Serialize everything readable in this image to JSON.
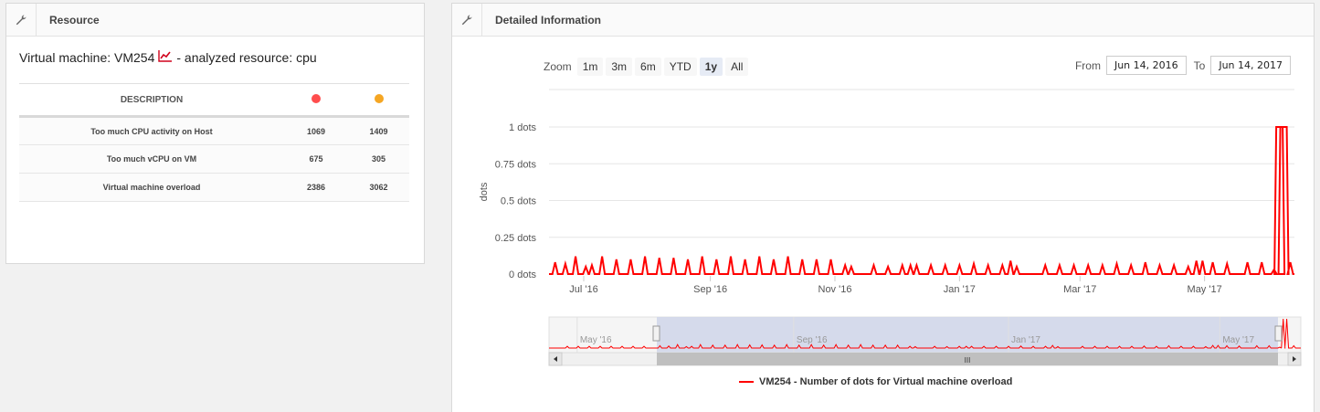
{
  "resource_panel": {
    "title": "Resource",
    "vm_prefix": "Virtual machine: VM254",
    "vm_suffix": "- analyzed resource: cpu",
    "table": {
      "header": "DESCRIPTION",
      "dot_colors": [
        "#ff4d4d",
        "#f5a623"
      ],
      "rows": [
        {
          "label": "Too much CPU activity on Host",
          "red": "1069",
          "orange": "1409"
        },
        {
          "label": "Too much vCPU on VM",
          "red": "675",
          "orange": "305"
        },
        {
          "label": "Virtual machine overload",
          "red": "2386",
          "orange": "3062"
        }
      ]
    }
  },
  "details_panel": {
    "title": "Detailed Information",
    "zoom": {
      "label": "Zoom",
      "buttons": [
        "1m",
        "3m",
        "6m",
        "YTD",
        "1y",
        "All"
      ],
      "active": "1y"
    },
    "range": {
      "from_label": "From",
      "from_value": "Jun 14, 2016",
      "to_label": "To",
      "to_value": "Jun 14, 2017"
    },
    "navigator_labels": [
      "May '16",
      "Sep '16",
      "Jan '17",
      "May '17"
    ],
    "navigator_scroll_symbol": "III"
  },
  "chart_data": {
    "type": "line",
    "ylabel": "dots",
    "y_ticks": [
      "0 dots",
      "0.25 dots",
      "0.5 dots",
      "0.75 dots",
      "1 dots"
    ],
    "ylim": [
      0,
      1
    ],
    "x_ticks": [
      "Jul '16",
      "Sep '16",
      "Nov '16",
      "Jan '17",
      "Mar '17",
      "May '17"
    ],
    "x_range": [
      "2016-06-14",
      "2017-06-14"
    ],
    "series": [
      {
        "name": "VM254 - Number of dots for Virtual machine overload",
        "color": "#ff0000",
        "peaks": [
          [
            "2016-06-17",
            0.08
          ],
          [
            "2016-06-22",
            0.07
          ],
          [
            "2016-06-27",
            0.12
          ],
          [
            "2016-07-02",
            0.05
          ],
          [
            "2016-07-05",
            0.06
          ],
          [
            "2016-07-10",
            0.12
          ],
          [
            "2016-07-17",
            0.1
          ],
          [
            "2016-07-24",
            0.1
          ],
          [
            "2016-07-31",
            0.12
          ],
          [
            "2016-08-07",
            0.11
          ],
          [
            "2016-08-14",
            0.11
          ],
          [
            "2016-08-21",
            0.1
          ],
          [
            "2016-08-28",
            0.12
          ],
          [
            "2016-09-04",
            0.1
          ],
          [
            "2016-09-11",
            0.12
          ],
          [
            "2016-09-18",
            0.1
          ],
          [
            "2016-09-25",
            0.12
          ],
          [
            "2016-10-02",
            0.1
          ],
          [
            "2016-10-09",
            0.12
          ],
          [
            "2016-10-16",
            0.1
          ],
          [
            "2016-10-23",
            0.1
          ],
          [
            "2016-10-30",
            0.1
          ],
          [
            "2016-11-06",
            0.06
          ],
          [
            "2016-11-09",
            0.05
          ],
          [
            "2016-11-20",
            0.06
          ],
          [
            "2016-11-27",
            0.05
          ],
          [
            "2016-12-04",
            0.06
          ],
          [
            "2016-12-08",
            0.06
          ],
          [
            "2016-12-11",
            0.06
          ],
          [
            "2016-12-18",
            0.06
          ],
          [
            "2016-12-25",
            0.06
          ],
          [
            "2017-01-01",
            0.06
          ],
          [
            "2017-01-08",
            0.07
          ],
          [
            "2017-01-15",
            0.06
          ],
          [
            "2017-01-22",
            0.06
          ],
          [
            "2017-01-26",
            0.09
          ],
          [
            "2017-01-29",
            0.05
          ],
          [
            "2017-02-12",
            0.06
          ],
          [
            "2017-02-19",
            0.06
          ],
          [
            "2017-02-26",
            0.06
          ],
          [
            "2017-03-05",
            0.06
          ],
          [
            "2017-03-12",
            0.06
          ],
          [
            "2017-03-19",
            0.07
          ],
          [
            "2017-03-26",
            0.06
          ],
          [
            "2017-04-02",
            0.08
          ],
          [
            "2017-04-09",
            0.06
          ],
          [
            "2017-04-16",
            0.06
          ],
          [
            "2017-04-23",
            0.05
          ],
          [
            "2017-04-27",
            0.09
          ],
          [
            "2017-04-30",
            0.09
          ],
          [
            "2017-05-05",
            0.08
          ],
          [
            "2017-05-12",
            0.07
          ],
          [
            "2017-05-22",
            0.08
          ],
          [
            "2017-05-29",
            0.08
          ],
          [
            "2017-06-04",
            0.03
          ],
          [
            "2017-06-06",
            1.0
          ],
          [
            "2017-06-08",
            1.0
          ],
          [
            "2017-06-12",
            0.08
          ]
        ]
      }
    ],
    "legend": "bottom-center"
  }
}
